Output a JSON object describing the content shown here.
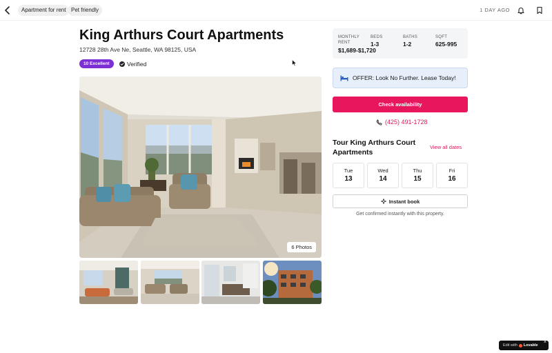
{
  "topbar": {
    "chips": [
      "Apartment for rent",
      "Pet friendly"
    ],
    "posted": "1 DAY AGO"
  },
  "listing": {
    "title": "King Arthurs Court Apartments",
    "address": "12728 28th Ave Ne, Seattle, WA 98125, USA",
    "rating_badge": "10 Excellent",
    "verified_label": "Verified",
    "photos_count_label": "6 Photos"
  },
  "stats": {
    "rent_label": "MONTHLY RENT",
    "rent_value": "$1,689-$1,720",
    "beds_label": "BEDS",
    "beds_value": "1-3",
    "baths_label": "BATHS",
    "baths_value": "1-2",
    "sqft_label": "SQFT",
    "sqft_value": "625-995"
  },
  "offer": {
    "text": "OFFER: Look No Further. Lease Today!"
  },
  "cta": {
    "check_availability": "Check availability",
    "phone": "(425) 491-1728"
  },
  "tour": {
    "title": "Tour King Arthurs Court Apartments",
    "view_all": "View all dates",
    "dates": [
      {
        "dow": "Tue",
        "day": "13"
      },
      {
        "dow": "Wed",
        "day": "14"
      },
      {
        "dow": "Thu",
        "day": "15"
      },
      {
        "dow": "Fri",
        "day": "16"
      }
    ],
    "instant_book": "Instant book",
    "instant_note": "Get confirmed instantly with this property."
  },
  "footer_badge": {
    "prefix": "Edit with",
    "brand": "Lovable",
    "close": "×"
  },
  "colors": {
    "accent": "#e8175d",
    "rating_badge": "#7c2fd4",
    "offer_bg": "#e7effb"
  },
  "icons": [
    "chevron-left-icon",
    "bell-icon",
    "bookmark-icon",
    "check-circle-icon",
    "bed-icon",
    "phone-icon",
    "sparkle-icon"
  ]
}
